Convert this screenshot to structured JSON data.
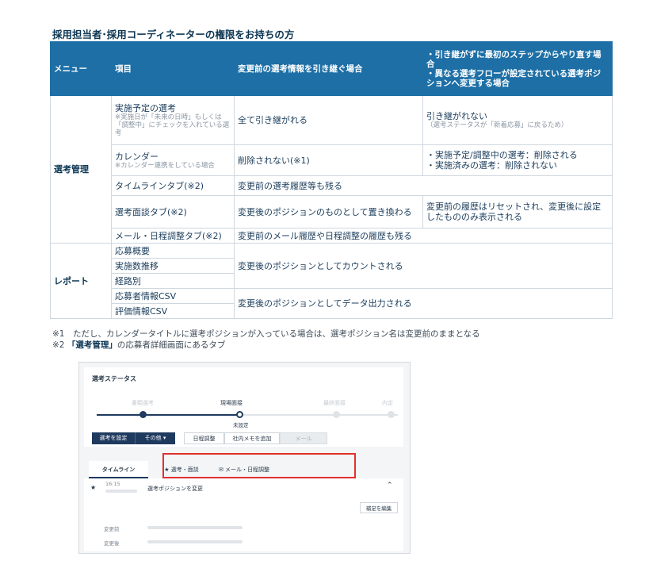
{
  "title": "採用担当者･採用コーディネーターの権限をお持ちの方",
  "table": {
    "headers": {
      "menu": "メニュー",
      "item": "項目",
      "inherit": "変更前の選考情報を引き継ぐ場合",
      "reset": "・引き継がずに最初のステップからやり直す場合\n・異なる選考フローが設定されている選考ポジションへ変更する場合"
    },
    "cat_selection": "選考管理",
    "cat_report": "レポート",
    "rows": {
      "scheduled": {
        "item": "実施予定の選考",
        "item_sub": "※実施日が「未来の日時」もしくは「調整中」にチェックを入れている選考",
        "inherit": "全て引き継がれる",
        "reset": "引き継がれない",
        "reset_sub": "（選考ステータスが「新着応募」に戻るため）"
      },
      "calendar": {
        "item": "カレンダー",
        "item_sub": "※カレンダー連携をしている場合",
        "inherit": "削除されない(※1)",
        "reset": "・実施予定/調整中の選考：削除される\n・実施済みの選考：削除されない"
      },
      "timeline": {
        "item": "タイムラインタブ(※2)",
        "merged": "変更前の選考履歴等も残る"
      },
      "interview": {
        "item": "選考面談タブ(※2)",
        "inherit": "変更後のポジションのものとして置き換わる",
        "reset": "変更前の履歴はリセットされ、変更後に設定したもののみ表示される"
      },
      "mail": {
        "item": "メール・日程調整タブ(※2)",
        "merged": "変更前のメール履歴や日程調整の履歴も残る"
      },
      "report": {
        "items": [
          "応募概要",
          "実施数推移",
          "経路別",
          "応募者情報CSV",
          "評価情報CSV"
        ],
        "count": "変更後のポジションとしてカウントされる",
        "output": "変更後のポジションとしてデータ出力される"
      }
    }
  },
  "notes": {
    "n1": "※1　ただし、カレンダータイトルに選考ポジションが入っている場合は、選考ポジション名は変更前のままとなる",
    "n2_prefix": "※2 ",
    "n2_bold": "「選考管理」",
    "n2_suffix": "の応募者詳細画面にあるタブ"
  },
  "screenshot": {
    "status_title": "選考ステータス",
    "steps": [
      "書類選考",
      "現場面接",
      "最終面接",
      "内定"
    ],
    "current_step_index": 1,
    "step_note": "未設定",
    "buttons": {
      "set_stage": "選考を設定",
      "other": "その他",
      "schedule": "日程調整",
      "add_memo": "社内メモを追加",
      "mail": "メール"
    },
    "tabs": {
      "timeline": "タイムライン",
      "interview": "選考・面談",
      "mail": "メール・日程調整"
    },
    "entry": {
      "time": "16:15",
      "text": "選考ポジションを変更",
      "edit": "補足を編集",
      "before": "変更前",
      "after": "変更後"
    },
    "colors": {
      "accent": "#1e3a5f",
      "highlight": "#e0302d",
      "header": "#1d6fa6"
    }
  }
}
